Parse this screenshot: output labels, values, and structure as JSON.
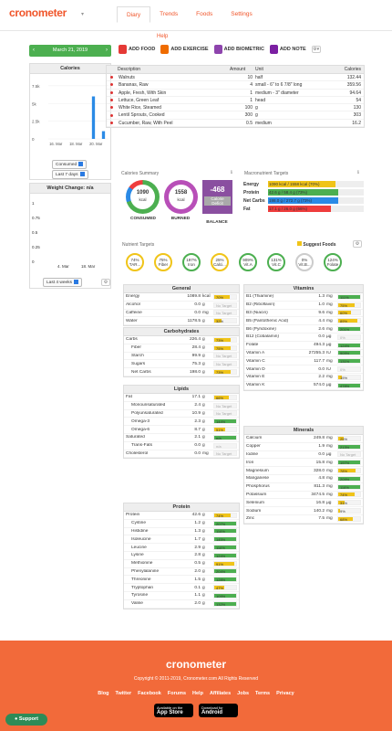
{
  "app": {
    "logo": "cronometer",
    "help": "Help"
  },
  "tabs": [
    "Diary",
    "Trends",
    "Foods",
    "Settings"
  ],
  "date": "March 21, 2019",
  "actions": [
    "ADD FOOD",
    "ADD EXERCISE",
    "ADD BIOMETRIC",
    "ADD NOTE"
  ],
  "calories_chart": {
    "title": "Calories",
    "yticks": [
      "7.5k",
      "5k",
      "2.5k",
      "0"
    ],
    "xticks": [
      "16. Mar",
      "18. Mar",
      "20. Mar"
    ],
    "dropdown1": "Consumed",
    "dropdown2": "Last 7 days",
    "chart_data": {
      "type": "bar",
      "categories": [
        "16. Mar",
        "17. Mar",
        "18. Mar",
        "19. Mar",
        "20. Mar",
        "21. Mar"
      ],
      "values": [
        0,
        0,
        0,
        0,
        6000,
        1090
      ],
      "ylim": [
        0,
        8000
      ],
      "xlabel": "",
      "ylabel": ""
    }
  },
  "weight_chart": {
    "title": "Weight Change: n/a",
    "yticks": [
      "1",
      "0.75",
      "0.5",
      "0.25",
      "0"
    ],
    "xticks": [
      "4. Mar",
      "18. Mar"
    ],
    "dropdown": "Last 4 weeks"
  },
  "diary": {
    "headers": [
      "Description",
      "Amount",
      "Unit",
      "Calories"
    ],
    "rows": [
      {
        "desc": "Walnuts",
        "amount": "10",
        "unit": "half",
        "cal": "132.44"
      },
      {
        "desc": "Bananas, Raw",
        "amount": "4",
        "unit": "small - 6\" to 6 7/8\" long",
        "cal": "359.56"
      },
      {
        "desc": "Apple, Fresh, With Skin",
        "amount": "1",
        "unit": "medium - 3\" diameter",
        "cal": "94.64"
      },
      {
        "desc": "Lettuce, Green Leaf",
        "amount": "1",
        "unit": "head",
        "cal": "54"
      },
      {
        "desc": "White Rice, Steamed",
        "amount": "100",
        "unit": "g",
        "cal": "130"
      },
      {
        "desc": "Lentil Sprouts, Cooked",
        "amount": "300",
        "unit": "g",
        "cal": "303"
      },
      {
        "desc": "Cucumber, Raw, With Peel",
        "amount": "0.5",
        "unit": "medium",
        "cal": "16.2"
      }
    ]
  },
  "summary": {
    "title": "Calories Summary",
    "consumed_val": "1090",
    "consumed_unit": "kcal",
    "consumed_label": "CONSUMED",
    "burned_val": "1558",
    "burned_unit": "kcal",
    "burned_label": "BURNED",
    "balance_val": "-468",
    "balance_sub1": "Calorie",
    "balance_sub2": "Deficit",
    "balance_label": "BALANCE"
  },
  "macros": {
    "title": "Macronutrient Targets",
    "rows": [
      {
        "label": "Energy",
        "text": "1090 kcal / 1558 kcal (70%)",
        "pct": 70,
        "color": "#f0c419"
      },
      {
        "label": "Protein",
        "text": "42.6 g / 58.4 g (73%)",
        "pct": 73,
        "color": "#4caf50"
      },
      {
        "label": "Net Carbs",
        "text": "198.0 g / 272.7 g (73%)",
        "pct": 73,
        "color": "#2a8ae6"
      },
      {
        "label": "Fat",
        "text": "17.1 g / 26.0 g (66%)",
        "pct": 66,
        "color": "#ef3d3d"
      }
    ]
  },
  "targets": {
    "title": "Nutrient Targets",
    "suggest": "Suggest Foods",
    "items": [
      {
        "pct": "74%",
        "name": "TAR...",
        "color": "#f0c419"
      },
      {
        "pct": "75%",
        "name": "Fiber",
        "color": "#f0c419"
      },
      {
        "pct": "197%",
        "name": "Iron",
        "color": "#4caf50"
      },
      {
        "pct": "25%",
        "name": "Calci...",
        "color": "#f0c419"
      },
      {
        "pct": "909%",
        "name": "Vit.A",
        "color": "#4caf50"
      },
      {
        "pct": "131%",
        "name": "Vit.C",
        "color": "#4caf50"
      },
      {
        "pct": "0%",
        "name": "Vit.B...",
        "color": "#cccccc"
      },
      {
        "pct": "124%",
        "name": "Folate",
        "color": "#4caf50"
      }
    ]
  },
  "general": {
    "title": "General",
    "rows": [
      {
        "n": "Energy",
        "v": "1089.8",
        "u": "kcal",
        "p": "70%",
        "pv": 70,
        "c": "#f0c419"
      },
      {
        "n": "Alcohol",
        "v": "0.0",
        "u": "g",
        "p": "No Target",
        "pv": 0,
        "c": "#ccc"
      },
      {
        "n": "Caffeine",
        "v": "0.0",
        "u": "mg",
        "p": "No Target",
        "pv": 0,
        "c": "#ccc"
      },
      {
        "n": "Water",
        "v": "1178.5",
        "u": "g",
        "p": "32%",
        "pv": 32,
        "c": "#f0c419"
      }
    ]
  },
  "carbs": {
    "title": "Carbohydrates",
    "rows": [
      {
        "n": "Carbs",
        "v": "226.4",
        "u": "g",
        "p": "73%",
        "pv": 73,
        "c": "#f0c419",
        "i": false
      },
      {
        "n": "Fiber",
        "v": "28.4",
        "u": "g",
        "p": "75%",
        "pv": 75,
        "c": "#f0c419",
        "i": true
      },
      {
        "n": "Starch",
        "v": "99.9",
        "u": "g",
        "p": "No Target",
        "pv": 0,
        "c": "#ccc",
        "i": true
      },
      {
        "n": "Sugars",
        "v": "75.3",
        "u": "g",
        "p": "No Target",
        "pv": 0,
        "c": "#ccc",
        "i": true
      },
      {
        "n": "Net Carbs",
        "v": "198.0",
        "u": "g",
        "p": "73%",
        "pv": 73,
        "c": "#f0c419",
        "i": true
      }
    ]
  },
  "lipids": {
    "title": "Lipids",
    "rows": [
      {
        "n": "Fat",
        "v": "17.1",
        "u": "g",
        "p": "66%",
        "pv": 66,
        "c": "#f0c419",
        "i": false
      },
      {
        "n": "Monounsaturated",
        "v": "2.4",
        "u": "g",
        "p": "No Target",
        "pv": 0,
        "c": "#ccc",
        "i": true
      },
      {
        "n": "Polyunsaturated",
        "v": "10.9",
        "u": "g",
        "p": "No Target",
        "pv": 0,
        "c": "#ccc",
        "i": true
      },
      {
        "n": "Omega-3",
        "v": "2.3",
        "u": "g",
        "p": "144%",
        "pv": 100,
        "c": "#4caf50",
        "i": true
      },
      {
        "n": "Omega-6",
        "v": "8.7",
        "u": "g",
        "p": "51%",
        "pv": 51,
        "c": "#f0c419",
        "i": true
      },
      {
        "n": "Saturated",
        "v": "2.1",
        "u": "g",
        "p": "n/a",
        "pv": 100,
        "c": "#4caf50",
        "i": false
      },
      {
        "n": "Trans-Fats",
        "v": "0.0",
        "u": "g",
        "p": "n/a",
        "pv": 0,
        "c": "#ccc",
        "i": true
      },
      {
        "n": "Cholesterol",
        "v": "0.0",
        "u": "mg",
        "p": "No Target",
        "pv": 0,
        "c": "#ccc",
        "i": false
      }
    ]
  },
  "protein": {
    "title": "Protein",
    "rows": [
      {
        "n": "Protein",
        "v": "42.6",
        "u": "g",
        "p": "74%",
        "pv": 74,
        "c": "#f0c419",
        "i": false
      },
      {
        "n": "Cystine",
        "v": "1.2",
        "u": "g",
        "p": "207%",
        "pv": 100,
        "c": "#4caf50",
        "i": true
      },
      {
        "n": "Histidine",
        "v": "1.3",
        "u": "g",
        "p": "116%",
        "pv": 100,
        "c": "#4caf50",
        "i": true
      },
      {
        "n": "Isoleucine",
        "v": "1.7",
        "u": "g",
        "p": "145%",
        "pv": 100,
        "c": "#4caf50",
        "i": true
      },
      {
        "n": "Leucine",
        "v": "2.9",
        "u": "g",
        "p": "116%",
        "pv": 100,
        "c": "#4caf50",
        "i": true
      },
      {
        "n": "Lysine",
        "v": "2.8",
        "u": "g",
        "p": "124%",
        "pv": 100,
        "c": "#4caf50",
        "i": true
      },
      {
        "n": "Methionine",
        "v": "0.5",
        "u": "g",
        "p": "91%",
        "pv": 91,
        "c": "#f0c419",
        "i": true
      },
      {
        "n": "Phenylalanine",
        "v": "2.0",
        "u": "g",
        "p": "204%",
        "pv": 100,
        "c": "#4caf50",
        "i": true
      },
      {
        "n": "Threonine",
        "v": "1.5",
        "u": "g",
        "p": "128%",
        "pv": 100,
        "c": "#4caf50",
        "i": true
      },
      {
        "n": "Tryptophan",
        "v": "0.1",
        "u": "g",
        "p": "47%",
        "pv": 47,
        "c": "#f0c419",
        "i": true
      },
      {
        "n": "Tyrosine",
        "v": "1.1",
        "u": "g",
        "p": "109%",
        "pv": 100,
        "c": "#4caf50",
        "i": true
      },
      {
        "n": "Valine",
        "v": "2.0",
        "u": "g",
        "p": "132%",
        "pv": 100,
        "c": "#4caf50",
        "i": true
      }
    ]
  },
  "vitamins": {
    "title": "Vitamins",
    "rows": [
      {
        "n": "B1 (Thiamine)",
        "v": "1.3",
        "u": "mg",
        "p": "111%",
        "pv": 100,
        "c": "#4caf50"
      },
      {
        "n": "B2 (Riboflavin)",
        "v": "1.0",
        "u": "mg",
        "p": "75%",
        "pv": 75,
        "c": "#f0c419"
      },
      {
        "n": "B3 (Niacin)",
        "v": "9.6",
        "u": "mg",
        "p": "60%",
        "pv": 60,
        "c": "#f0c419"
      },
      {
        "n": "B5 (Pantothenic Acid)",
        "v": "4.4",
        "u": "mg",
        "p": "89%",
        "pv": 89,
        "c": "#f0c419"
      },
      {
        "n": "B6 (Pyridoxine)",
        "v": "2.6",
        "u": "mg",
        "p": "201%",
        "pv": 100,
        "c": "#4caf50"
      },
      {
        "n": "B12 (Cobalamin)",
        "v": "0.0",
        "u": "µg",
        "p": "0%",
        "pv": 0,
        "c": "#ccc"
      },
      {
        "n": "Folate",
        "v": "494.3",
        "u": "µg",
        "p": "124%",
        "pv": 100,
        "c": "#4caf50"
      },
      {
        "n": "Vitamin A",
        "v": "27255.3",
        "u": "IU",
        "p": "909%",
        "pv": 100,
        "c": "#4caf50"
      },
      {
        "n": "Vitamin C",
        "v": "117.7",
        "u": "mg",
        "p": "131%",
        "pv": 100,
        "c": "#4caf50"
      },
      {
        "n": "Vitamin D",
        "v": "0.0",
        "u": "IU",
        "p": "0%",
        "pv": 0,
        "c": "#ccc"
      },
      {
        "n": "Vitamin E",
        "v": "2.2",
        "u": "mg",
        "p": "15%",
        "pv": 15,
        "c": "#f0c419"
      },
      {
        "n": "Vitamin K",
        "v": "574.0",
        "u": "µg",
        "p": "478%",
        "pv": 100,
        "c": "#4caf50"
      }
    ]
  },
  "minerals": {
    "title": "Minerals",
    "rows": [
      {
        "n": "Calcium",
        "v": "249.8",
        "u": "mg",
        "p": "25%",
        "pv": 25,
        "c": "#f0c419"
      },
      {
        "n": "Copper",
        "v": "1.9",
        "u": "mg",
        "p": "213%",
        "pv": 100,
        "c": "#4caf50"
      },
      {
        "n": "Iodine",
        "v": "0.0",
        "u": "µg",
        "p": "No Target",
        "pv": 0,
        "c": "#ccc"
      },
      {
        "n": "Iron",
        "v": "15.8",
        "u": "mg",
        "p": "197%",
        "pv": 100,
        "c": "#4caf50"
      },
      {
        "n": "Magnesium",
        "v": "328.0",
        "u": "mg",
        "p": "78%",
        "pv": 78,
        "c": "#f0c419"
      },
      {
        "n": "Manganese",
        "v": "4.8",
        "u": "mg",
        "p": "209%",
        "pv": 100,
        "c": "#4caf50"
      },
      {
        "n": "Phosphorus",
        "v": "811.3",
        "u": "mg",
        "p": "116%",
        "pv": 100,
        "c": "#4caf50"
      },
      {
        "n": "Potassium",
        "v": "3474.5",
        "u": "mg",
        "p": "74%",
        "pv": 74,
        "c": "#f0c419"
      },
      {
        "n": "Selenium",
        "v": "16.8",
        "u": "µg",
        "p": "31%",
        "pv": 31,
        "c": "#f0c419"
      },
      {
        "n": "Sodium",
        "v": "140.2",
        "u": "mg",
        "p": "9%",
        "pv": 9,
        "c": "#f0c419"
      },
      {
        "n": "Zinc",
        "v": "7.5",
        "u": "mg",
        "p": "68%",
        "pv": 68,
        "c": "#f0c419"
      }
    ]
  },
  "footer": {
    "logo": "cronometer",
    "copyright": "Copyright © 2011-2019, Cronometer.com All Rights Reserved",
    "links": [
      "Blog",
      "Twitter",
      "Facebook",
      "Forums",
      "Help",
      "Affiliates",
      "Jobs",
      "Terms",
      "Privacy"
    ],
    "appstore_small": "Available on the",
    "appstore": "App Store",
    "android_small": "Download for",
    "android": "Android",
    "support": "Support"
  },
  "colors": {
    "brand": "#f0552a",
    "green": "#4caf50",
    "footer": "#f26a3a"
  }
}
